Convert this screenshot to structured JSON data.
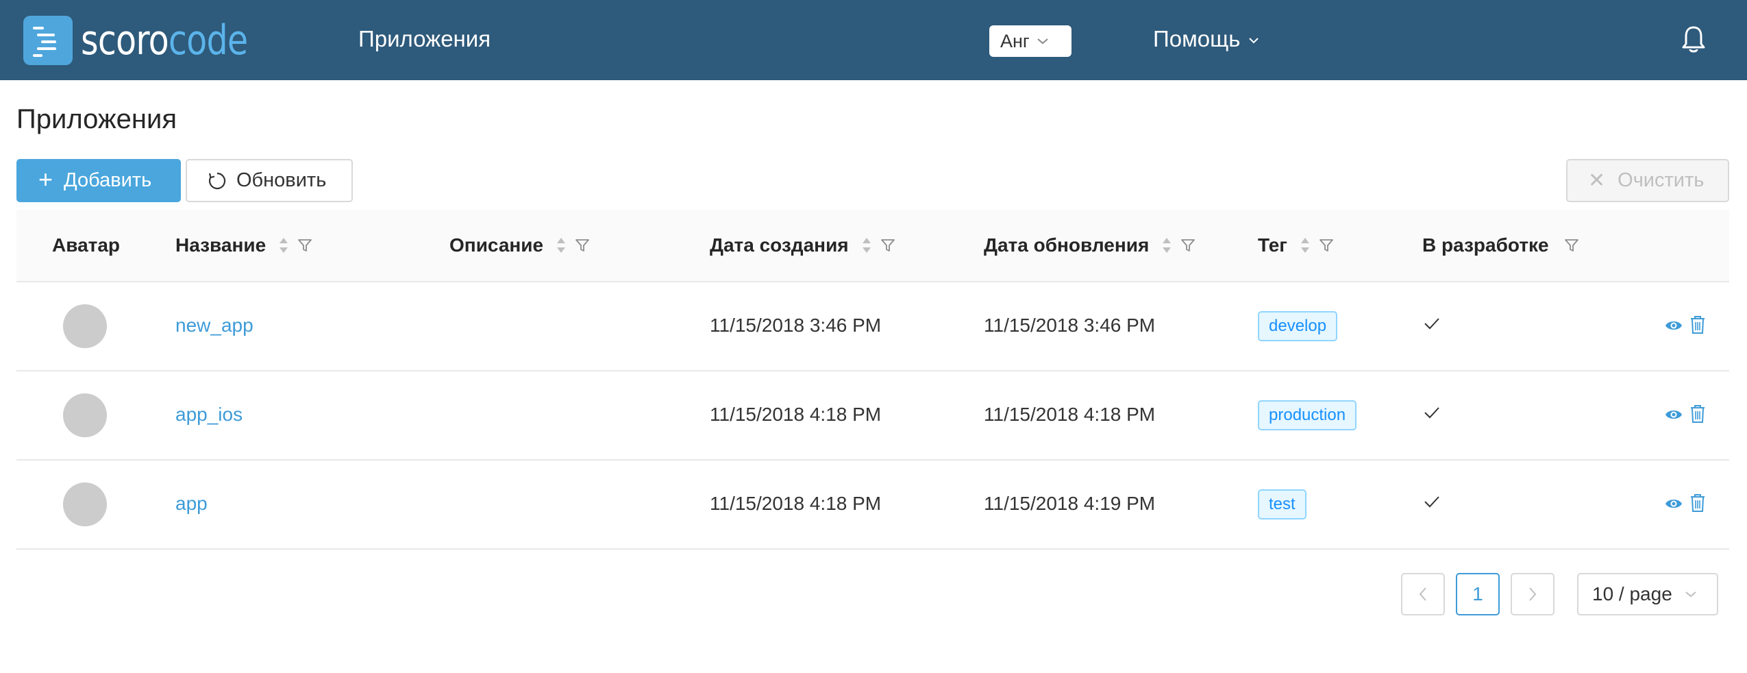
{
  "header": {
    "logo_prefix": "scoro",
    "logo_suffix": "code",
    "nav_apps": "Приложения",
    "language": "Анг",
    "help": "Помощь"
  },
  "page": {
    "title": "Приложения",
    "add_label": "Добавить",
    "refresh_label": "Обновить",
    "clear_label": "Очистить"
  },
  "table": {
    "columns": {
      "avatar": "Аватар",
      "name": "Название",
      "description": "Описание",
      "created": "Дата создания",
      "updated": "Дата обновления",
      "tag": "Тег",
      "in_dev": "В разработке"
    },
    "rows": [
      {
        "name": "new_app",
        "description": "",
        "created": "11/15/2018 3:46 PM",
        "updated": "11/15/2018 3:46 PM",
        "tag": "develop",
        "in_dev": true
      },
      {
        "name": "app_ios",
        "description": "",
        "created": "11/15/2018 4:18 PM",
        "updated": "11/15/2018 4:18 PM",
        "tag": "production",
        "in_dev": true
      },
      {
        "name": "app",
        "description": "",
        "created": "11/15/2018 4:18 PM",
        "updated": "11/15/2018 4:19 PM",
        "tag": "test",
        "in_dev": true
      }
    ]
  },
  "pagination": {
    "current_page": "1",
    "page_size": "10 / page"
  },
  "colors": {
    "header_bg": "#2e5a7b",
    "accent": "#4aa6dd",
    "link": "#3e9bd8",
    "tag_border": "#91d5ff"
  },
  "icons": [
    "bell-icon",
    "plus-icon",
    "reload-icon",
    "close-icon",
    "sort-icon",
    "filter-icon",
    "check-icon",
    "eye-icon",
    "trash-icon",
    "chevron-left-icon",
    "chevron-right-icon",
    "chevron-down-icon"
  ]
}
